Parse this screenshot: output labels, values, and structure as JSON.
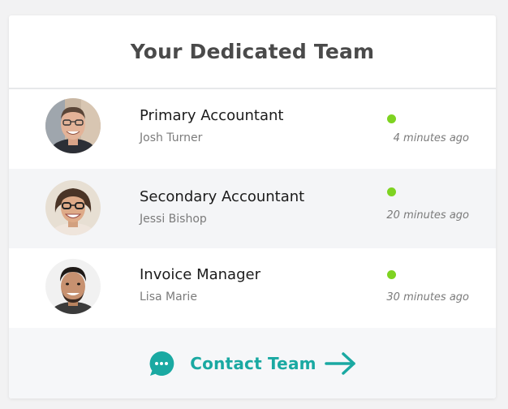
{
  "title": "Your Dedicated Team",
  "members": [
    {
      "role": "Primary Accountant",
      "name": "Josh Turner",
      "last_active": "4 minutes ago",
      "status": "online"
    },
    {
      "role": "Secondary Accountant",
      "name": "Jessi Bishop",
      "last_active": "20 minutes ago",
      "status": "online"
    },
    {
      "role": "Invoice Manager",
      "name": "Lisa Marie",
      "last_active": "30 minutes ago",
      "status": "online"
    }
  ],
  "cta": {
    "label": "Contact Team",
    "icon": "chat-bubble-icon",
    "arrow_icon": "arrow-right-icon"
  },
  "colors": {
    "accent": "#1aa9a2",
    "status_online": "#7ed321",
    "alt_row": "#f4f5f7",
    "footer_bg": "#f6f7f9"
  }
}
